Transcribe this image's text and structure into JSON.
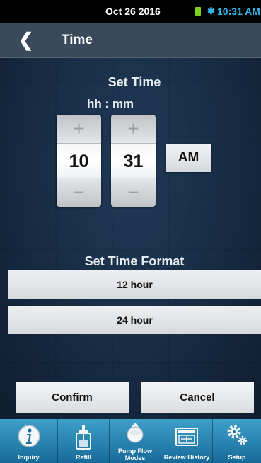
{
  "status_bar": {
    "date": "Oct 26 2016",
    "time": "10:31 AM"
  },
  "header": {
    "back_glyph": "❮",
    "title": "Time"
  },
  "set_time": {
    "title": "Set Time",
    "format_hint": "hh : mm",
    "hour": "10",
    "minute": "31",
    "plus_glyph": "+",
    "minus_glyph": "−",
    "period": "AM"
  },
  "time_format": {
    "title": "Set Time Format",
    "options": [
      "12 hour",
      "24 hour"
    ]
  },
  "actions": {
    "confirm": "Confirm",
    "cancel": "Cancel"
  },
  "nav": {
    "items": [
      {
        "label": "Inquiry",
        "icon": "info-icon"
      },
      {
        "label": "Refill",
        "icon": "refill-icon"
      },
      {
        "label": "Pump Flow Modes",
        "icon": "pump-flow-icon"
      },
      {
        "label": "Review History",
        "icon": "history-icon"
      },
      {
        "label": "Setup",
        "icon": "gears-icon"
      }
    ]
  },
  "colors": {
    "accent": "#35b6ea",
    "battery": "#7dd321",
    "header": "#3b4a5a",
    "nav": "#2a86b5",
    "background": "#172c44"
  }
}
